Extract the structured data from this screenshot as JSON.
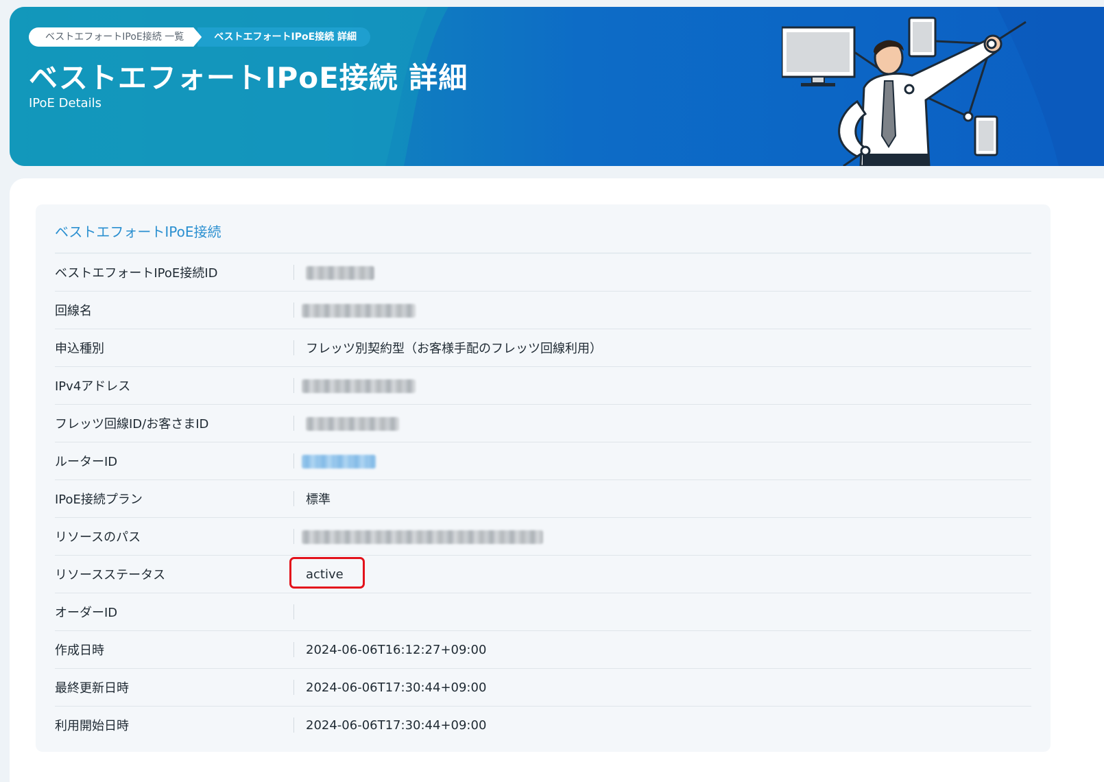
{
  "header": {
    "breadcrumb": {
      "list_label": "ベストエフォートIPoE接続 一覧",
      "current_label": "ベストエフォートIPoE接続 詳細"
    },
    "title": "ベストエフォートIPoE接続 詳細",
    "subtitle": "IPoE Details",
    "illustration_icon": "businessman-network-devices-illustration"
  },
  "detail": {
    "section_title": "ベストエフォートIPoE接続",
    "rows": [
      {
        "label": "ベストエフォートIPoE接続ID",
        "value": "",
        "masked": true
      },
      {
        "label": "回線名",
        "value": "",
        "masked": true
      },
      {
        "label": "申込種別",
        "value": "フレッツ別契約型（お客様手配のフレッツ回線利用）"
      },
      {
        "label": "IPv4アドレス",
        "value": "",
        "masked": true
      },
      {
        "label": "フレッツ回線ID/お客さまID",
        "value": "",
        "masked": true
      },
      {
        "label": "ルーターID",
        "value": "",
        "masked": true,
        "link": true
      },
      {
        "label": "IPoE接続プラン",
        "value": "標準"
      },
      {
        "label": "リソースのパス",
        "value": "",
        "masked": true
      },
      {
        "label": "リソースステータス",
        "value": "active",
        "highlighted": true
      },
      {
        "label": "オーダーID",
        "value": ""
      },
      {
        "label": "作成日時",
        "value": "2024-06-06T16:12:27+09:00"
      },
      {
        "label": "最終更新日時",
        "value": "2024-06-06T17:30:44+09:00"
      },
      {
        "label": "利用開始日時",
        "value": "2024-06-06T17:30:44+09:00"
      }
    ]
  },
  "colors": {
    "banner_start": "#0f90b6",
    "banner_end": "#0b5fc4",
    "section_title": "#2a8fd0",
    "highlight": "#e3121b",
    "link": "#2a8fd0"
  }
}
